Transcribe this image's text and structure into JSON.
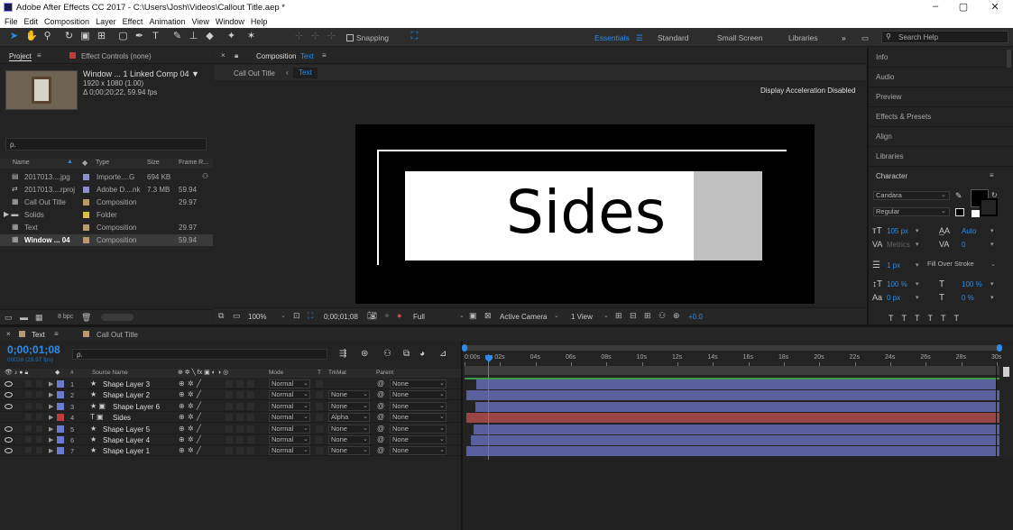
{
  "window": {
    "title": "Adobe After Effects CC 2017 - C:\\Users\\Josh\\Videos\\Callout Title.aep *",
    "min": "–",
    "max": "▢",
    "close": "✕"
  },
  "menu": [
    "File",
    "Edit",
    "Composition",
    "Layer",
    "Effect",
    "Animation",
    "View",
    "Window",
    "Help"
  ],
  "toolbar": {
    "snapping": "Snapping"
  },
  "workspaces": [
    "Essentials",
    "Standard",
    "Small Screen",
    "Libraries"
  ],
  "search_help": "Search Help",
  "project": {
    "tab": "Project",
    "effect_tab": "Effect Controls (none)",
    "comp_name": "Window ... 1 Linked Comp 04 ▼",
    "comp_res": "1920 x 1080 (1.00)",
    "comp_dur": "Δ 0;00;20;22, 59.94 fps",
    "search_placeholder": "ρ.",
    "columns": [
      "Name",
      "Type",
      "Size",
      "Frame R..."
    ],
    "items": [
      {
        "name": "2017013....jpg",
        "type": "Importe....G",
        "size": "694 KB",
        "fr": "",
        "color": "#8e8ec8"
      },
      {
        "name": "2017013....rproj",
        "type": "Adobe D....nk",
        "size": "7.3 MB",
        "fr": "59.94",
        "color": "#8e8ec8"
      },
      {
        "name": "Call Out Title",
        "type": "Composition",
        "size": "",
        "fr": "29.97",
        "color": "#b59a72"
      },
      {
        "name": "Solids",
        "type": "Folder",
        "size": "",
        "fr": "",
        "color": "#d4c246"
      },
      {
        "name": "Text",
        "type": "Composition",
        "size": "",
        "fr": "29.97",
        "color": "#b59a72"
      },
      {
        "name": "Window ... 04",
        "type": "Composition",
        "size": "",
        "fr": "59.94",
        "color": "#b59a72"
      }
    ],
    "bpc": "8 bpc"
  },
  "composition": {
    "tab": "Composition",
    "tab_name": "Text",
    "breadcrumbs": [
      "Call Out Title",
      "Text"
    ],
    "accel": "Display Acceleration Disabled",
    "canvas_text": "Sides"
  },
  "viewer_bar": {
    "zoom": "100%",
    "time": "0;00;01;08",
    "resolution": "Full",
    "camera": "Active Camera",
    "views": "1 View",
    "exposure": "+0.0"
  },
  "right_panels": [
    "Info",
    "Audio",
    "Preview",
    "Effects & Presets",
    "Align",
    "Libraries"
  ],
  "character": {
    "title": "Character",
    "font": "Candara",
    "style": "Regular",
    "size": "105 px",
    "leading": "Auto",
    "kerning": "Metrics",
    "tracking": "0",
    "stroke_width": "1 px",
    "stroke_mode": "Fill Over Stroke",
    "vscale": "100 %",
    "hscale": "100 %",
    "baseline": "0 px",
    "tsume": "0 %"
  },
  "timeline": {
    "tabs": [
      "Text",
      "Call Out Title"
    ],
    "timecode": "0;00;01;08",
    "frames": "00038 (29.97 fps)",
    "search_placeholder": "ρ.",
    "columns": {
      "num": "#",
      "source": "Source Name",
      "mode": "Mode",
      "t": "T",
      "trkmat": "TrkMat",
      "parent": "Parent"
    },
    "ruler": [
      "0:00s",
      "02s",
      "04s",
      "06s",
      "08s",
      "10s",
      "12s",
      "14s",
      "16s",
      "18s",
      "20s",
      "22s",
      "24s",
      "26s",
      "28s",
      "30s"
    ],
    "layers": [
      {
        "num": "1",
        "name": "Shape Layer 3",
        "mode": "Normal",
        "trkmat": "",
        "parent": "None",
        "color": "#6b7bd0",
        "icon": "★",
        "bar": "#5a5f9e"
      },
      {
        "num": "2",
        "name": "Shape Layer 2",
        "mode": "Normal",
        "trkmat": "None",
        "parent": "None",
        "color": "#6b7bd0",
        "icon": "★",
        "bar": "#5a5f9e"
      },
      {
        "num": "3",
        "name": "Shape Layer 6",
        "mode": "Normal",
        "trkmat": "None",
        "parent": "None",
        "color": "#6b7bd0",
        "icon": "★ ▣",
        "bar": "#5a5f9e"
      },
      {
        "num": "4",
        "name": "Sides",
        "mode": "Normal",
        "trkmat": "Alpha",
        "parent": "None",
        "color": "#c23a3a",
        "icon": "T ▣",
        "bar": "#9a4646"
      },
      {
        "num": "5",
        "name": "Shape Layer 5",
        "mode": "Normal",
        "trkmat": "None",
        "parent": "None",
        "color": "#6b7bd0",
        "icon": "★",
        "bar": "#5a5f9e"
      },
      {
        "num": "6",
        "name": "Shape Layer 4",
        "mode": "Normal",
        "trkmat": "None",
        "parent": "None",
        "color": "#6b7bd0",
        "icon": "★",
        "bar": "#5a5f9e"
      },
      {
        "num": "7",
        "name": "Shape Layer 1",
        "mode": "Normal",
        "trkmat": "None",
        "parent": "None",
        "color": "#6b7bd0",
        "icon": "★",
        "bar": "#5a5f9e"
      }
    ]
  },
  "colors": {
    "accent": "#2d8ceb",
    "panel": "#232323",
    "layer_shape": "#5a5f9e",
    "layer_text": "#9a4646"
  }
}
